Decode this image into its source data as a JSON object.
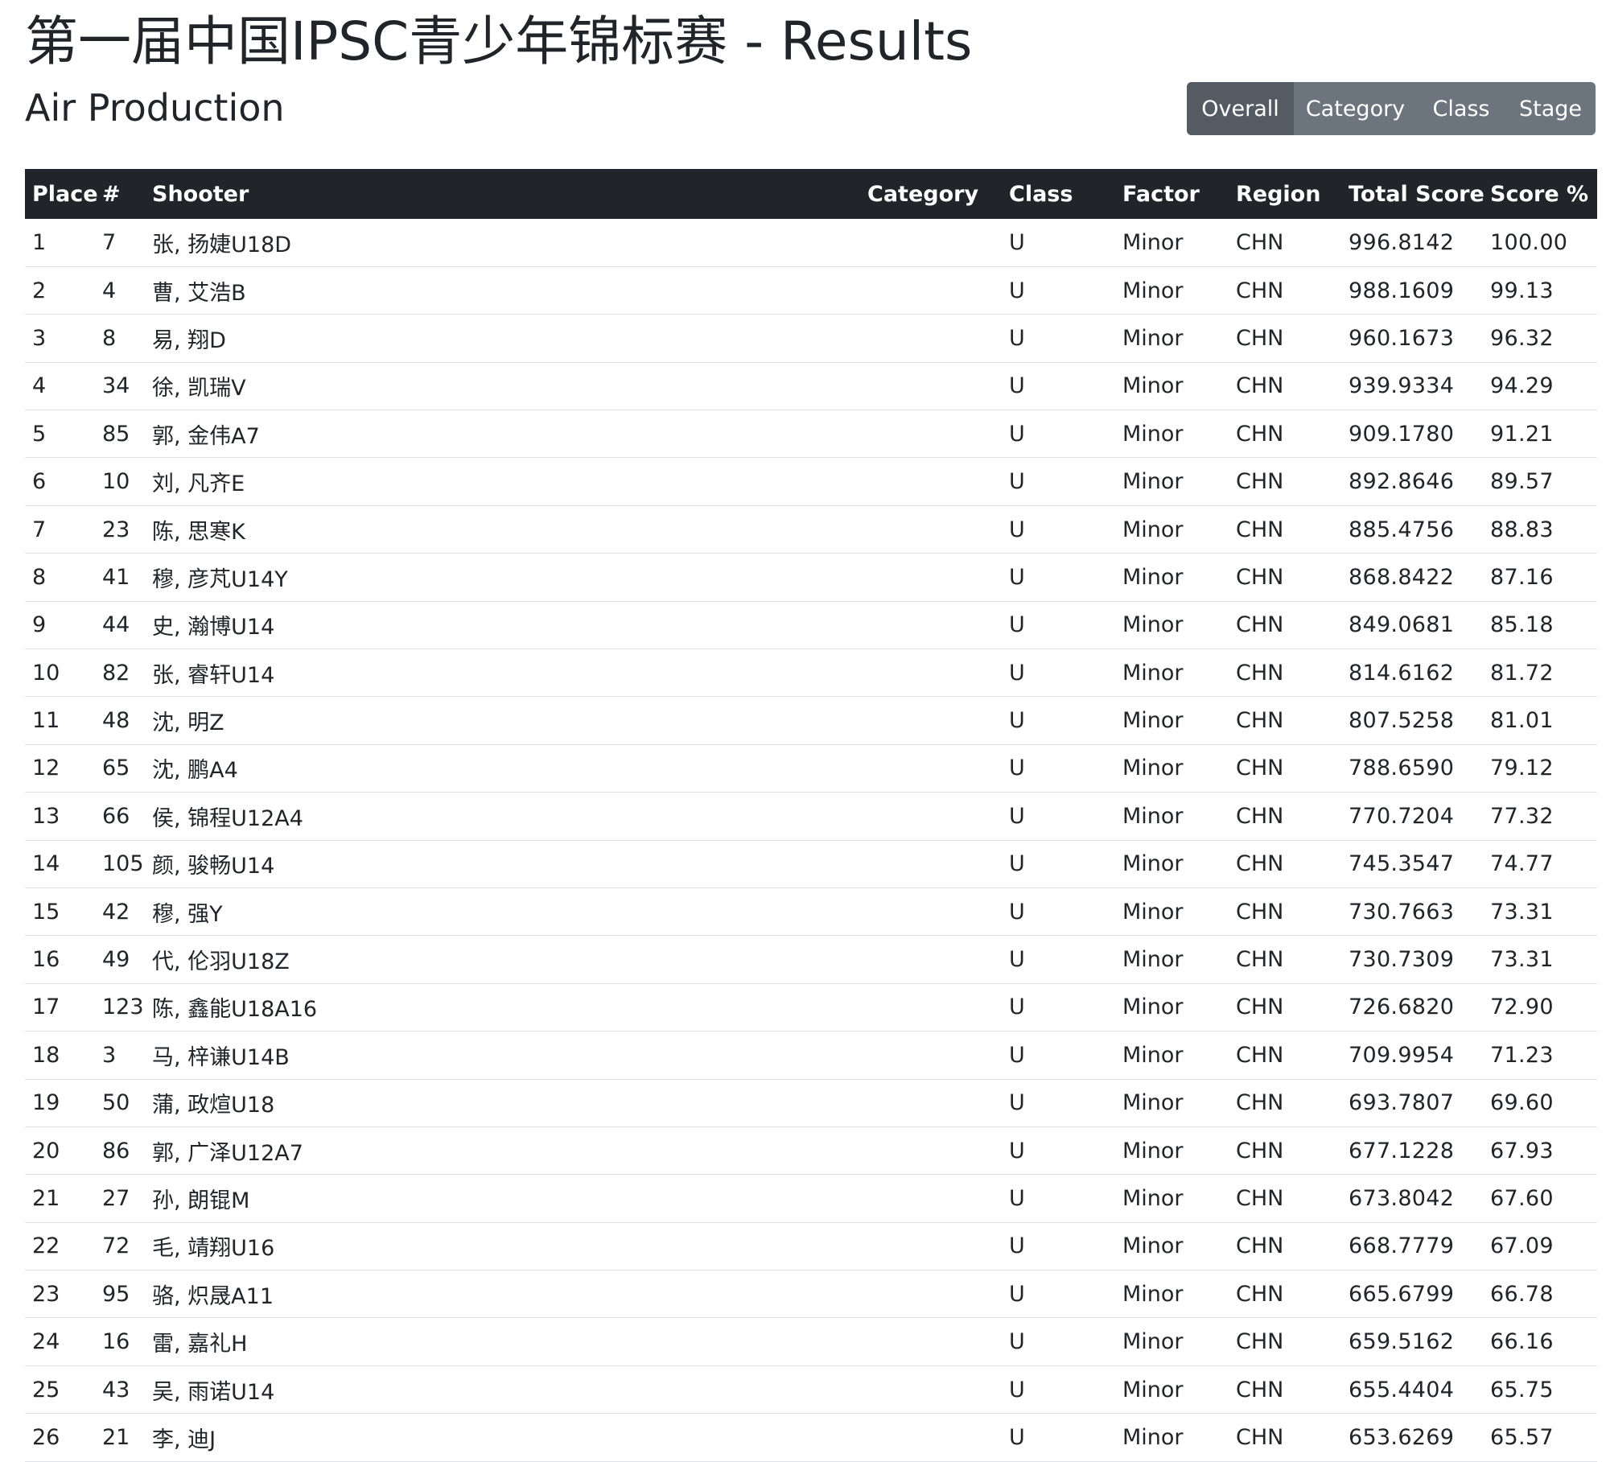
{
  "header": {
    "title": "第一届中国IPSC青少年锦标赛 - Results",
    "subtitle": "Air Production"
  },
  "tabs": [
    {
      "label": "Overall",
      "active": true
    },
    {
      "label": "Category",
      "active": false
    },
    {
      "label": "Class",
      "active": false
    },
    {
      "label": "Stage",
      "active": false
    }
  ],
  "colors": {
    "header_bg": "#212529",
    "tab_bg": "#6c757d",
    "tab_active_bg": "#545b62",
    "row_border": "#dee2e6"
  },
  "table": {
    "columns": {
      "place": "Place",
      "number": "#",
      "shooter": "Shooter",
      "category": "Category",
      "class": "Class",
      "factor": "Factor",
      "region": "Region",
      "total_score": "Total Score",
      "score_pct": "Score %"
    },
    "rows": [
      {
        "place": "1",
        "number": "7",
        "shooter": "张, 扬婕U18D",
        "category": "",
        "class": "U",
        "factor": "Minor",
        "region": "CHN",
        "total_score": "996.8142",
        "score_pct": "100.00"
      },
      {
        "place": "2",
        "number": "4",
        "shooter": "曹, 艾浩B",
        "category": "",
        "class": "U",
        "factor": "Minor",
        "region": "CHN",
        "total_score": "988.1609",
        "score_pct": "99.13"
      },
      {
        "place": "3",
        "number": "8",
        "shooter": "易, 翔D",
        "category": "",
        "class": "U",
        "factor": "Minor",
        "region": "CHN",
        "total_score": "960.1673",
        "score_pct": "96.32"
      },
      {
        "place": "4",
        "number": "34",
        "shooter": "徐, 凯瑞V",
        "category": "",
        "class": "U",
        "factor": "Minor",
        "region": "CHN",
        "total_score": "939.9334",
        "score_pct": "94.29"
      },
      {
        "place": "5",
        "number": "85",
        "shooter": "郭, 金伟A7",
        "category": "",
        "class": "U",
        "factor": "Minor",
        "region": "CHN",
        "total_score": "909.1780",
        "score_pct": "91.21"
      },
      {
        "place": "6",
        "number": "10",
        "shooter": "刘, 凡齐E",
        "category": "",
        "class": "U",
        "factor": "Minor",
        "region": "CHN",
        "total_score": "892.8646",
        "score_pct": "89.57"
      },
      {
        "place": "7",
        "number": "23",
        "shooter": "陈, 思寒K",
        "category": "",
        "class": "U",
        "factor": "Minor",
        "region": "CHN",
        "total_score": "885.4756",
        "score_pct": "88.83"
      },
      {
        "place": "8",
        "number": "41",
        "shooter": "穆, 彦芃U14Y",
        "category": "",
        "class": "U",
        "factor": "Minor",
        "region": "CHN",
        "total_score": "868.8422",
        "score_pct": "87.16"
      },
      {
        "place": "9",
        "number": "44",
        "shooter": "史, 瀚博U14",
        "category": "",
        "class": "U",
        "factor": "Minor",
        "region": "CHN",
        "total_score": "849.0681",
        "score_pct": "85.18"
      },
      {
        "place": "10",
        "number": "82",
        "shooter": "张, 睿轩U14",
        "category": "",
        "class": "U",
        "factor": "Minor",
        "region": "CHN",
        "total_score": "814.6162",
        "score_pct": "81.72"
      },
      {
        "place": "11",
        "number": "48",
        "shooter": "沈, 明Z",
        "category": "",
        "class": "U",
        "factor": "Minor",
        "region": "CHN",
        "total_score": "807.5258",
        "score_pct": "81.01"
      },
      {
        "place": "12",
        "number": "65",
        "shooter": "沈, 鹏A4",
        "category": "",
        "class": "U",
        "factor": "Minor",
        "region": "CHN",
        "total_score": "788.6590",
        "score_pct": "79.12"
      },
      {
        "place": "13",
        "number": "66",
        "shooter": "侯, 锦程U12A4",
        "category": "",
        "class": "U",
        "factor": "Minor",
        "region": "CHN",
        "total_score": "770.7204",
        "score_pct": "77.32"
      },
      {
        "place": "14",
        "number": "105",
        "shooter": "颜, 骏畅U14",
        "category": "",
        "class": "U",
        "factor": "Minor",
        "region": "CHN",
        "total_score": "745.3547",
        "score_pct": "74.77"
      },
      {
        "place": "15",
        "number": "42",
        "shooter": "穆, 强Y",
        "category": "",
        "class": "U",
        "factor": "Minor",
        "region": "CHN",
        "total_score": "730.7663",
        "score_pct": "73.31"
      },
      {
        "place": "16",
        "number": "49",
        "shooter": "代, 伦羽U18Z",
        "category": "",
        "class": "U",
        "factor": "Minor",
        "region": "CHN",
        "total_score": "730.7309",
        "score_pct": "73.31"
      },
      {
        "place": "17",
        "number": "123",
        "shooter": "陈, 鑫能U18A16",
        "category": "",
        "class": "U",
        "factor": "Minor",
        "region": "CHN",
        "total_score": "726.6820",
        "score_pct": "72.90"
      },
      {
        "place": "18",
        "number": "3",
        "shooter": "马, 梓谦U14B",
        "category": "",
        "class": "U",
        "factor": "Minor",
        "region": "CHN",
        "total_score": "709.9954",
        "score_pct": "71.23"
      },
      {
        "place": "19",
        "number": "50",
        "shooter": "蒲, 政煊U18",
        "category": "",
        "class": "U",
        "factor": "Minor",
        "region": "CHN",
        "total_score": "693.7807",
        "score_pct": "69.60"
      },
      {
        "place": "20",
        "number": "86",
        "shooter": "郭, 广泽U12A7",
        "category": "",
        "class": "U",
        "factor": "Minor",
        "region": "CHN",
        "total_score": "677.1228",
        "score_pct": "67.93"
      },
      {
        "place": "21",
        "number": "27",
        "shooter": "孙, 朗锟M",
        "category": "",
        "class": "U",
        "factor": "Minor",
        "region": "CHN",
        "total_score": "673.8042",
        "score_pct": "67.60"
      },
      {
        "place": "22",
        "number": "72",
        "shooter": "毛, 靖翔U16",
        "category": "",
        "class": "U",
        "factor": "Minor",
        "region": "CHN",
        "total_score": "668.7779",
        "score_pct": "67.09"
      },
      {
        "place": "23",
        "number": "95",
        "shooter": "骆, 炽晟A11",
        "category": "",
        "class": "U",
        "factor": "Minor",
        "region": "CHN",
        "total_score": "665.6799",
        "score_pct": "66.78"
      },
      {
        "place": "24",
        "number": "16",
        "shooter": "雷, 嘉礼H",
        "category": "",
        "class": "U",
        "factor": "Minor",
        "region": "CHN",
        "total_score": "659.5162",
        "score_pct": "66.16"
      },
      {
        "place": "25",
        "number": "43",
        "shooter": "吴, 雨诺U14",
        "category": "",
        "class": "U",
        "factor": "Minor",
        "region": "CHN",
        "total_score": "655.4404",
        "score_pct": "65.75"
      },
      {
        "place": "26",
        "number": "21",
        "shooter": "李, 迪J",
        "category": "",
        "class": "U",
        "factor": "Minor",
        "region": "CHN",
        "total_score": "653.6269",
        "score_pct": "65.57"
      }
    ]
  }
}
